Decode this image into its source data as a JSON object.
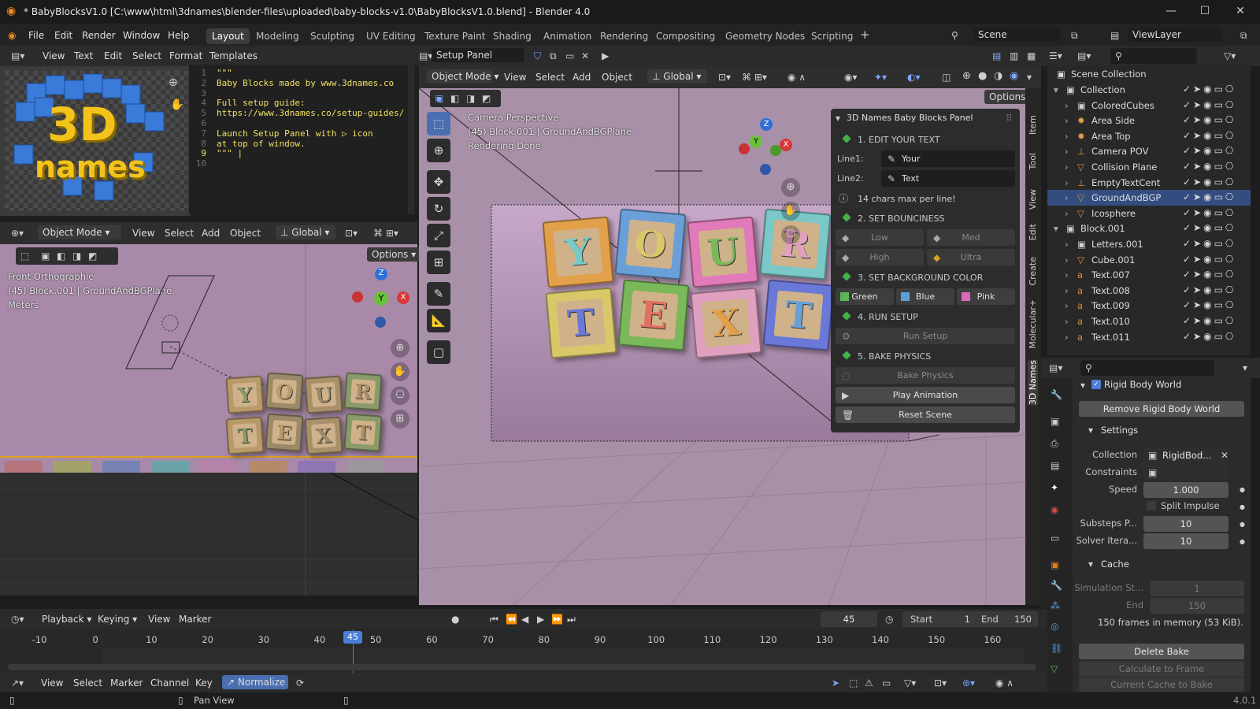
{
  "window": {
    "title": "* BabyBlocksV1.0 [C:\\www\\html\\3dnames\\blender-files\\uploaded\\baby-blocks-v1.0\\BabyBlocksV1.0.blend] - Blender 4.0",
    "minimize": "—",
    "maximize": "☐",
    "close": "✕"
  },
  "menu": [
    "File",
    "Edit",
    "Render",
    "Window",
    "Help"
  ],
  "workspaces": [
    "Layout",
    "Modeling",
    "Sculpting",
    "UV Editing",
    "Texture Paint",
    "Shading",
    "Animation",
    "Rendering",
    "Compositing",
    "Geometry Nodes",
    "Scripting"
  ],
  "scene": {
    "label": "Scene",
    "viewlayer": "ViewLayer"
  },
  "text_editor": {
    "menus": [
      "View",
      "Text",
      "Edit",
      "Select",
      "Format",
      "Templates"
    ],
    "file": "Setup Panel",
    "lines": [
      "\"\"\"",
      "Baby Blocks made by www.3dnames.co",
      "",
      "Full setup guide:",
      "https://www.3dnames.co/setup-guides/",
      "",
      "Launch Setup Panel with ▷ icon",
      "at top of window.",
      "\"\"\" |",
      ""
    ]
  },
  "image": {
    "logo_line1": "3D",
    "logo_line2": "names"
  },
  "front_vp": {
    "mode": "Object Mode",
    "menus": [
      "View",
      "Select",
      "Add",
      "Object"
    ],
    "orientation": "Global",
    "options": "Options",
    "info": [
      "Front Orthographic",
      "(45) Block.001 | GroundAndBGPlane",
      "Meters"
    ],
    "blocks_top": [
      "Y",
      "O",
      "U",
      "R"
    ],
    "blocks_bottom": [
      "T",
      "E",
      "X",
      "T"
    ],
    "swatches": [
      "#b86f6f",
      "#a0a85a",
      "#6a7fb8",
      "#5aa8a8",
      "#b87fa8",
      "#b88a5a",
      "#8a6fb8",
      "#9a9a9a"
    ]
  },
  "main_vp": {
    "mode": "Object Mode",
    "menus": [
      "View",
      "Select",
      "Add",
      "Object"
    ],
    "orientation": "Global",
    "options": "Options",
    "info": [
      "Camera Perspective",
      "(45) Block.001 | GroundAndBGPlane",
      "Rendering Done"
    ],
    "blocks_top": [
      "Y",
      "O",
      "U",
      "R"
    ],
    "blocks_bottom": [
      "T",
      "E",
      "X",
      "T"
    ],
    "block_colors": [
      "#e2a04a",
      "#6a9fd8",
      "#e07ab8",
      "#7ac8c8",
      "#d8c86a",
      "#7ab85a",
      "#e0a0c0",
      "#6a78d8",
      "#e07060"
    ]
  },
  "gizmo": {
    "z": "Z",
    "y": "Y",
    "x": "X"
  },
  "npanel": {
    "title": "3D Names Baby Blocks Panel",
    "s1": "1. EDIT YOUR TEXT",
    "line1_label": "Line1:",
    "line1": "Your",
    "line2_label": "Line2:",
    "line2": "Text",
    "hint": "14 chars max per line!",
    "s2": "2. SET BOUNCINESS",
    "low": "Low",
    "med": "Med",
    "high": "High",
    "ultra": "Ultra",
    "s3": "3. SET BACKGROUND COLOR",
    "green": "Green",
    "blue": "Blue",
    "pink": "Pink",
    "s4": "4. RUN SETUP",
    "run": "Run Setup",
    "s5": "5. BAKE PHYSICS",
    "bake": "Bake Physics",
    "play": "Play Animation",
    "reset": "Reset Scene"
  },
  "sidetabs": [
    "Item",
    "Tool",
    "View",
    "Edit",
    "Create",
    "Molecular+",
    "3D Names"
  ],
  "outliner": {
    "root": "Scene Collection",
    "items": [
      {
        "name": "Collection",
        "indent": 1,
        "icon": "▣"
      },
      {
        "name": "ColoredCubes",
        "indent": 2,
        "icon": "▣"
      },
      {
        "name": "Area Side",
        "indent": 2,
        "icon": "✹"
      },
      {
        "name": "Area Top",
        "indent": 2,
        "icon": "✹"
      },
      {
        "name": "Camera POV",
        "indent": 2,
        "icon": "⊥"
      },
      {
        "name": "Collision Plane",
        "indent": 2,
        "icon": "▽"
      },
      {
        "name": "EmptyTextCent",
        "indent": 2,
        "icon": "⊥"
      },
      {
        "name": "GroundAndBGP",
        "indent": 2,
        "icon": "▽",
        "selected": true
      },
      {
        "name": "Icosphere",
        "indent": 2,
        "icon": "▽"
      },
      {
        "name": "Block.001",
        "indent": 1,
        "icon": "▣"
      },
      {
        "name": "Letters.001",
        "indent": 2,
        "icon": "▣"
      },
      {
        "name": "Cube.001",
        "indent": 2,
        "icon": "▽"
      },
      {
        "name": "Text.007",
        "indent": 2,
        "icon": "a"
      },
      {
        "name": "Text.008",
        "indent": 2,
        "icon": "a"
      },
      {
        "name": "Text.009",
        "indent": 2,
        "icon": "a"
      },
      {
        "name": "Text.010",
        "indent": 2,
        "icon": "a"
      },
      {
        "name": "Text.011",
        "indent": 2,
        "icon": "a"
      }
    ]
  },
  "props": {
    "rbw": "Rigid Body World",
    "remove": "Remove Rigid Body World",
    "settings": "Settings",
    "collection_label": "Collection",
    "collection": "RigidBod...",
    "constraints_label": "Constraints",
    "speed_label": "Speed",
    "speed": "1.000",
    "split": "Split Impulse",
    "substeps_label": "Substeps P...",
    "substeps": "10",
    "solver_label": "Solver Itera...",
    "solver": "10",
    "cache": "Cache",
    "simstart_label": "Simulation St...",
    "simstart": "1",
    "end_label": "End",
    "end": "150",
    "mem": "150 frames in memory (53 KiB).",
    "delete": "Delete Bake",
    "calc": "Calculate to Frame",
    "current": "Current Cache to Bake"
  },
  "timeline": {
    "menus": [
      "Playback",
      "Keying",
      "View",
      "Marker"
    ],
    "frame": "45",
    "start_label": "Start",
    "start": "1",
    "end_label": "End",
    "end": "150",
    "ticks": [
      "-10",
      "0",
      "10",
      "20",
      "30",
      "40",
      "45",
      "50",
      "60",
      "70",
      "80",
      "90",
      "100",
      "110",
      "120",
      "130",
      "140",
      "150",
      "160"
    ]
  },
  "graph": {
    "menus": [
      "View",
      "Select",
      "Marker",
      "Channel",
      "Key"
    ],
    "normalize": "Normalize"
  },
  "status": {
    "pan": "Pan View",
    "version": "4.0.1"
  }
}
